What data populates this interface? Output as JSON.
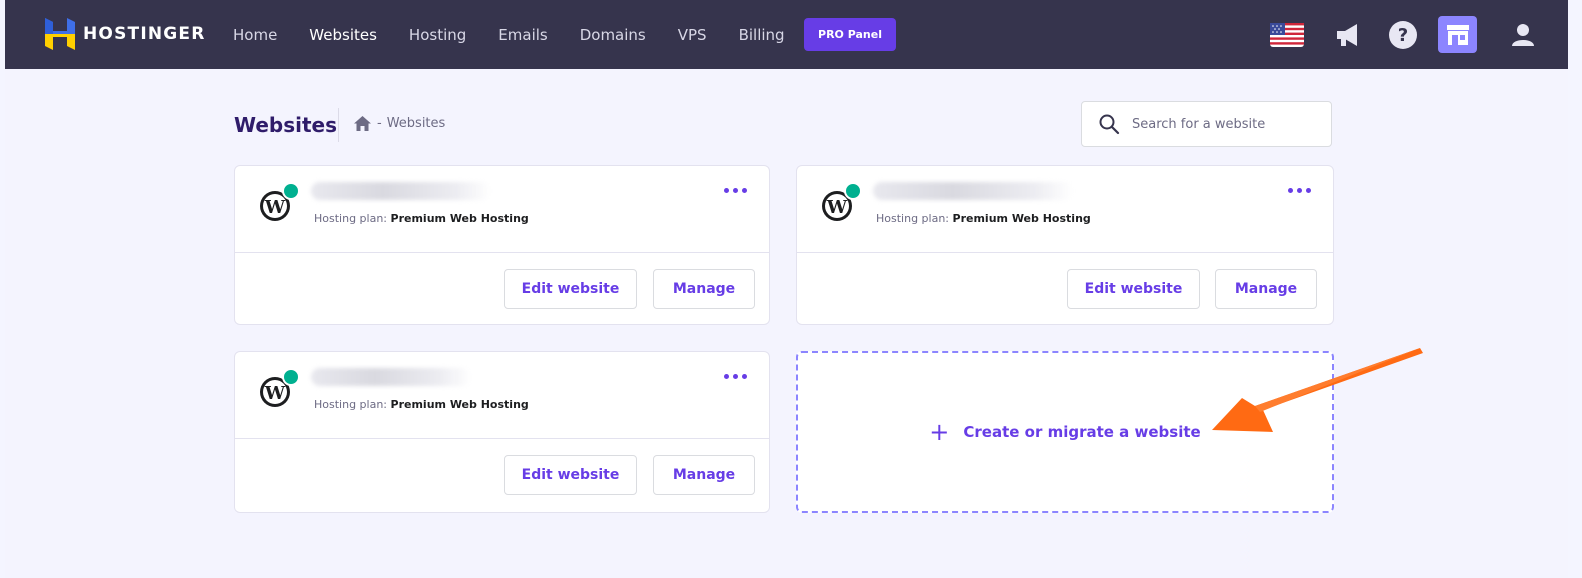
{
  "brand": {
    "name": "HOSTINGER"
  },
  "nav": {
    "items": [
      {
        "label": "Home",
        "active": false
      },
      {
        "label": "Websites",
        "active": true
      },
      {
        "label": "Hosting",
        "active": false
      },
      {
        "label": "Emails",
        "active": false
      },
      {
        "label": "Domains",
        "active": false
      },
      {
        "label": "VPS",
        "active": false
      },
      {
        "label": "Billing",
        "active": false
      }
    ],
    "pro_panel_label": "PRO Panel"
  },
  "topbar_icons": [
    "us-flag-icon",
    "megaphone-icon",
    "help-icon",
    "store-icon",
    "user-icon"
  ],
  "page": {
    "title": "Websites",
    "breadcrumb": {
      "sep": "-",
      "current": "Websites"
    },
    "search_placeholder": "Search for a website"
  },
  "websites": [
    {
      "plan_label": "Hosting plan:",
      "plan_name": "Premium Web Hosting",
      "edit_label": "Edit website",
      "manage_label": "Manage"
    },
    {
      "plan_label": "Hosting plan:",
      "plan_name": "Premium Web Hosting",
      "edit_label": "Edit website",
      "manage_label": "Manage"
    },
    {
      "plan_label": "Hosting plan:",
      "plan_name": "Premium Web Hosting",
      "edit_label": "Edit website",
      "manage_label": "Manage"
    }
  ],
  "create": {
    "plus": "+",
    "label": "Create or migrate a website"
  },
  "colors": {
    "topbar": "#36344d",
    "accent": "#673de6",
    "status_online": "#00b090",
    "annotation_arrow": "#ff6a13"
  }
}
